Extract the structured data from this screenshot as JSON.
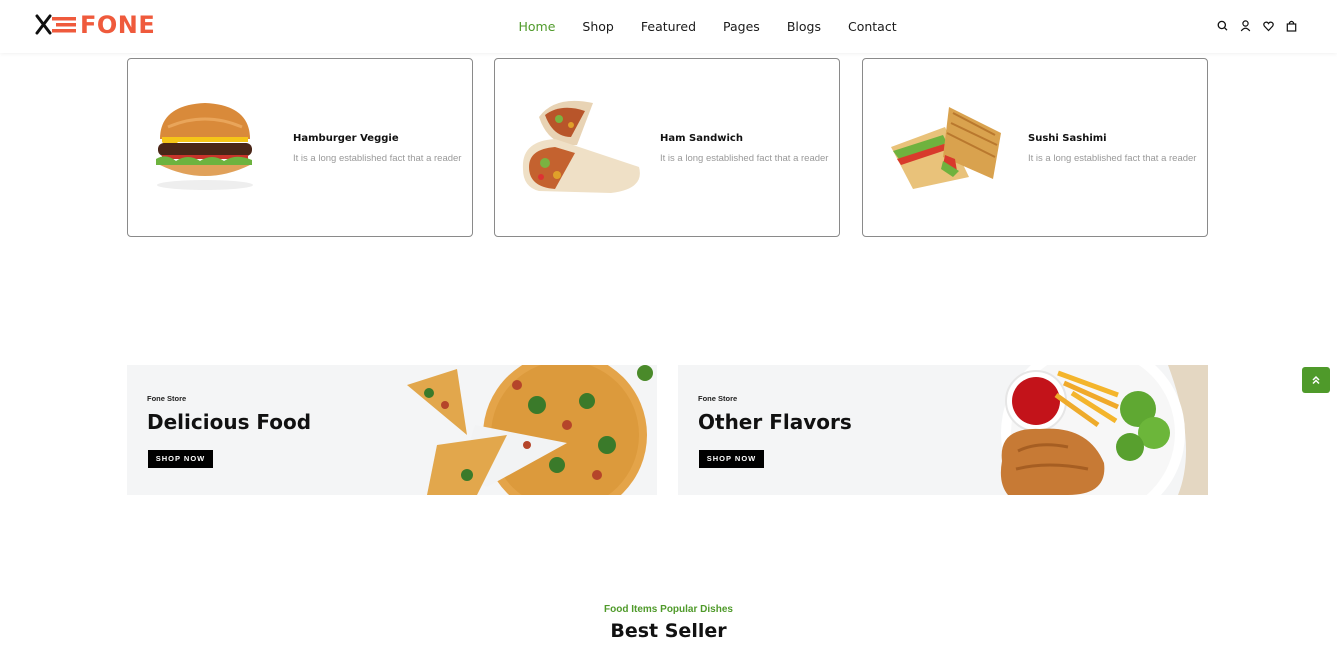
{
  "brand": {
    "name": "FONE",
    "color": "#ef5a3c"
  },
  "nav": {
    "items": [
      "Home",
      "Shop",
      "Featured",
      "Pages",
      "Blogs",
      "Contact"
    ],
    "active_color": "#4f9a2a"
  },
  "header_icons": [
    "search-icon",
    "user-icon",
    "heart-icon",
    "bag-icon"
  ],
  "cards": [
    {
      "title": "Hamburger Veggie",
      "desc": "It is a long established fact that a reader"
    },
    {
      "title": "Ham Sandwich",
      "desc": "It is a long established fact that a reader"
    },
    {
      "title": "Sushi Sashimi",
      "desc": "It is a long established fact that a reader"
    }
  ],
  "banners": [
    {
      "store": "Fone Store",
      "heading": "Delicious Food",
      "button": "SHOP NOW"
    },
    {
      "store": "Fone Store",
      "heading": "Other Flavors",
      "button": "SHOP NOW"
    }
  ],
  "section": {
    "subtitle": "Food Items Popular Dishes",
    "title": "Best Seller"
  },
  "colors": {
    "accent": "#4f9a2a",
    "brand": "#ef5a3c",
    "card_border": "#8a8a8a"
  }
}
